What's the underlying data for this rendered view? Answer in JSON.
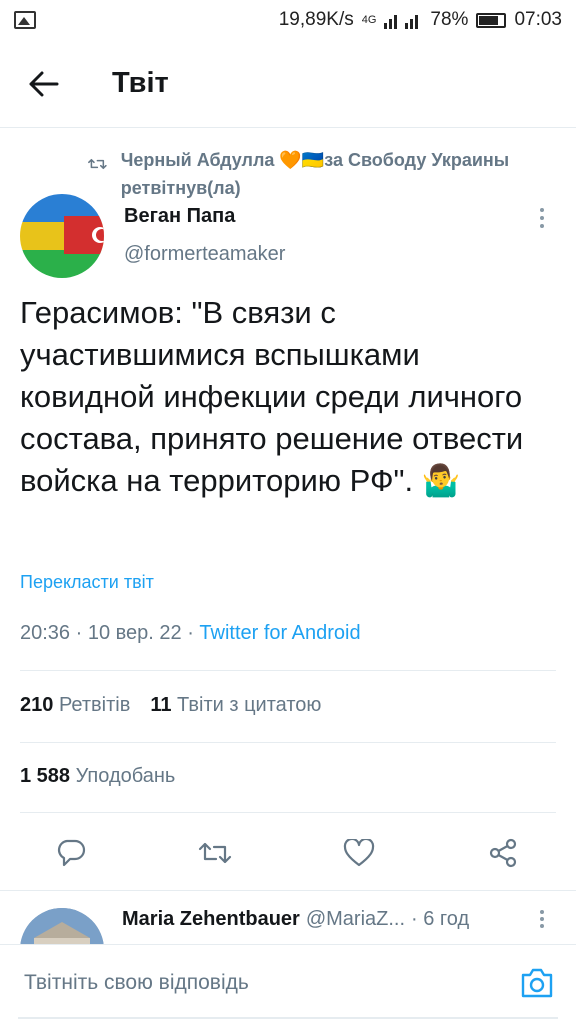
{
  "status_bar": {
    "speed": "19,89K/s",
    "network": "4G",
    "battery": "78%",
    "battery_level": 0.78,
    "time": "07:03"
  },
  "header": {
    "title": "Твіт"
  },
  "tweet": {
    "retweeted_by": "Черный Абдулла 🧡🇺🇦за Свободу Украины ретвітнув(ла)",
    "author_name": "Веган Папа",
    "author_handle": "@formerteamaker",
    "text": "Герасимов: \"В связи с участившимися вспышками ковидной инфекции среди личного состава, принято решение отвести войска на территорию РФ\". 🤷‍♂",
    "translate": "Перекласти твіт",
    "time": "20:36 · 10 вер. 22 · ",
    "source": "Twitter for Android",
    "retweets_count": "210",
    "retweets_label": "Ретвітів",
    "quotes_count": "11",
    "quotes_label": "Твіти з цитатою",
    "likes_count": "1 588",
    "likes_label": "Уподобань"
  },
  "reply": {
    "name": "Maria Zehentbauer",
    "handle": "@MariaZ...",
    "time": "· 6 год"
  },
  "composer": {
    "placeholder": "Твітніть свою відповідь"
  },
  "colors": {
    "accent": "#1da1f2",
    "secondary_text": "#657786"
  }
}
